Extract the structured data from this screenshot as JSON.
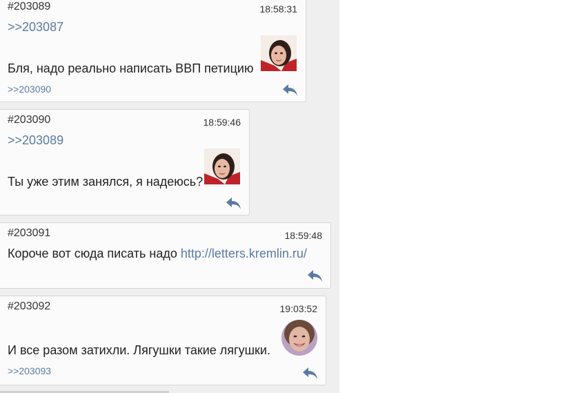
{
  "posts": [
    {
      "number": "#203089",
      "time": "18:58:31",
      "quote": ">>203087",
      "text": "Бля, надо реально написать ВВП петицию",
      "reply_ref": ">>203090",
      "avatar": "girl-portrait-avatar"
    },
    {
      "number": "#203090",
      "time": "18:59:46",
      "quote": ">>203089",
      "text": "Ты уже этим занялся, я надеюсь?",
      "avatar": "girl-portrait-avatar"
    },
    {
      "number": "#203091",
      "time": "18:59:48",
      "text_prefix": "Короче вот сюда писать надо ",
      "link": "http://letters.kremlin.ru/"
    },
    {
      "number": "#203092",
      "time": "19:03:52",
      "text": "И все разом затихли. Лягушки такие лягушки.",
      "reply_ref": ">>203093",
      "avatar": "smiling-woman-avatar"
    }
  ],
  "icons": {
    "reply": "reply-arrow-icon"
  },
  "colors": {
    "link": "#5b7aa3",
    "post_bg": "#fbfbfb",
    "thread_bg": "#efefef"
  }
}
